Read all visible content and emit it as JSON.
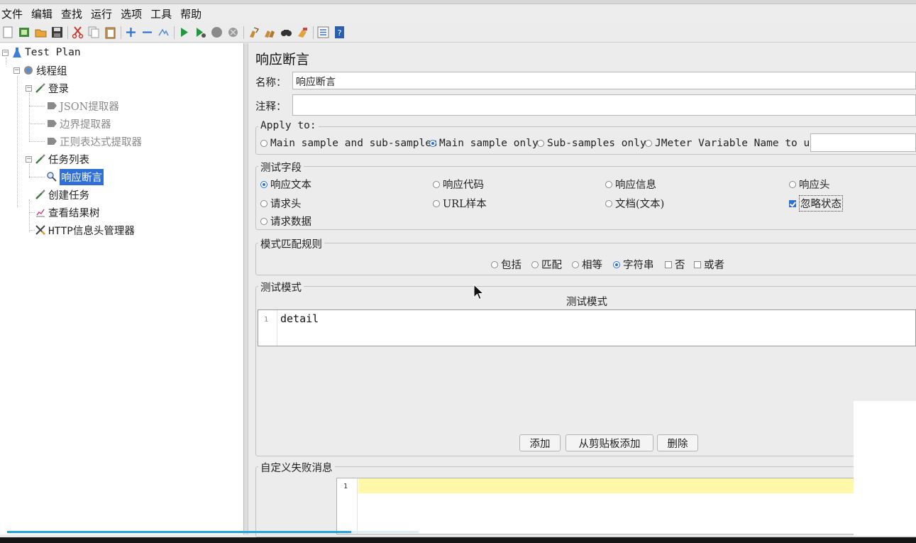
{
  "menu": [
    "文件",
    "编辑",
    "查找",
    "运行",
    "选项",
    "工具",
    "帮助"
  ],
  "toolbar_icons": [
    "new-icon",
    "templates-icon",
    "open-icon",
    "save-icon",
    "cut-icon",
    "copy-icon",
    "paste-icon",
    "expand-icon",
    "collapse-icon",
    "toggle-icon",
    "start-icon",
    "start-no-pause-icon",
    "stop-icon",
    "shutdown-icon",
    "clear-icon",
    "clear-all-icon",
    "search-icon",
    "reset-search-icon",
    "function-helper-icon",
    "help-icon"
  ],
  "tree": {
    "test_plan": "Test Plan",
    "thread_group": "线程组",
    "login": "登录",
    "json_extractor": "JSON提取器",
    "boundary_extractor": "边界提取器",
    "regex_extractor": "正则表达式提取器",
    "task_list": "任务列表",
    "response_assertion": "响应断言",
    "create_task": "创建任务",
    "view_results_tree": "查看结果树",
    "http_header_manager": "HTTP信息头管理器"
  },
  "panel": {
    "title": "响应断言",
    "name_label": "名称：",
    "name_value": "响应断言",
    "comment_label": "注释：",
    "comment_value": "",
    "apply_to": {
      "title": "Apply to:",
      "options": [
        "Main sample and sub-samples",
        "Main sample only",
        "Sub-samples only",
        "JMeter Variable Name to use"
      ],
      "selected": "Main sample only",
      "variable_value": ""
    },
    "test_field": {
      "title": "测试字段",
      "options": [
        "响应文本",
        "响应代码",
        "响应信息",
        "响应头",
        "请求头",
        "URL样本",
        "文档(文本)",
        "忽略状态",
        "请求数据"
      ],
      "selected": "响应文本",
      "ignore_status_checked": true
    },
    "pattern_rules": {
      "title": "模式匹配规则",
      "options": [
        "包括",
        "匹配",
        "相等",
        "字符串",
        "否",
        "或者"
      ],
      "selected": "字符串"
    },
    "test_patterns": {
      "title": "测试模式",
      "column_header": "测试模式",
      "rows": [
        {
          "line": "1",
          "value": "detail"
        }
      ],
      "buttons": {
        "add": "添加",
        "add_clipboard": "从剪贴板添加",
        "delete": "删除"
      }
    },
    "failure_message": {
      "title": "自定义失败消息",
      "line": "1",
      "value": ""
    }
  },
  "colors": {
    "selection": "#2f6fd6",
    "highlight_line": "#fff8a8",
    "progress": "#23a4dc"
  }
}
